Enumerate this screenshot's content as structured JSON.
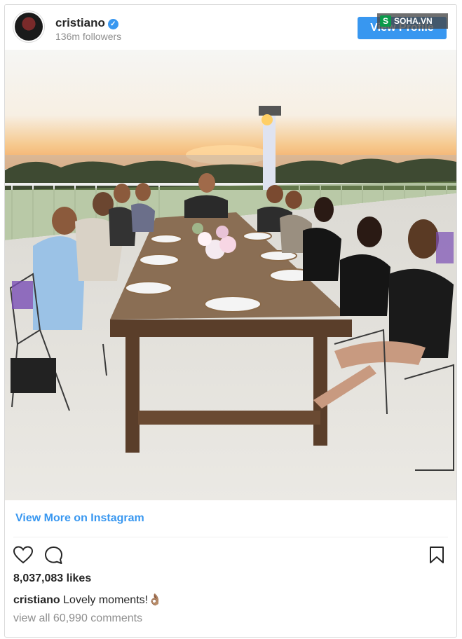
{
  "post": {
    "username": "cristiano",
    "verified_mark": "✓",
    "followers": "136m followers",
    "view_profile_label": "View Profile",
    "watermark": "SOHA.VN",
    "watermark_logo": "S",
    "photo_description_icon": "dinner-photo",
    "view_more_label": "View More on Instagram",
    "likes": "8,037,083 likes",
    "caption_user": "cristiano",
    "caption_text": "Lovely moments!👌🏽",
    "comments_link": "view all 60,990 comments"
  },
  "colors": {
    "accent": "#3897f0",
    "text": "#262626",
    "muted": "#8e8e8e",
    "border": "#dbdbdb"
  },
  "icons": [
    "heart-icon",
    "comment-icon",
    "bookmark-icon",
    "verified-badge-icon"
  ]
}
